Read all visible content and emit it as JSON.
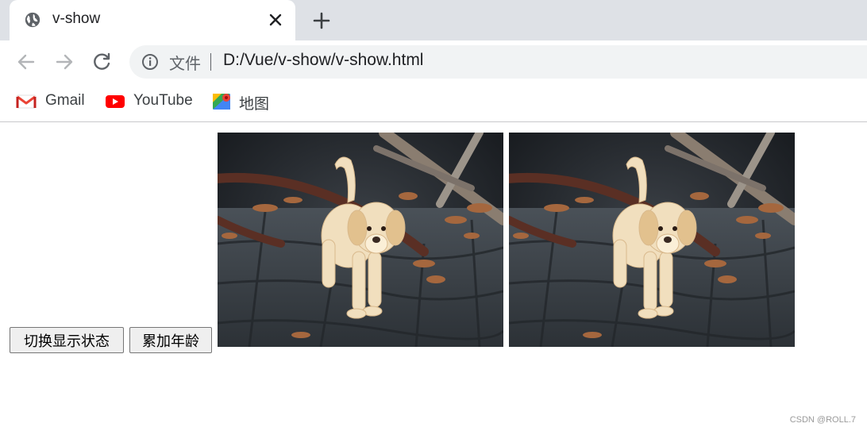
{
  "browser": {
    "tab": {
      "title": "v-show"
    },
    "address_bar": {
      "scheme_label": "文件",
      "url": "D:/Vue/v-show/v-show.html"
    },
    "bookmarks": [
      {
        "label": "Gmail",
        "icon": "gmail-icon"
      },
      {
        "label": "YouTube",
        "icon": "youtube-icon"
      },
      {
        "label": "地图",
        "icon": "maps-icon"
      }
    ]
  },
  "page": {
    "buttons": {
      "toggle_label": "切换显示状态",
      "age_label": "累加年龄"
    },
    "images": [
      {
        "subject": "puppy photo"
      },
      {
        "subject": "puppy photo"
      }
    ]
  },
  "watermark": "CSDN @ROLL.7",
  "colors": {
    "tabstrip": "#dee1e6",
    "omnibox": "#f1f3f4",
    "youtube_red": "#ff0000",
    "gmail_red": "#ea4335"
  }
}
